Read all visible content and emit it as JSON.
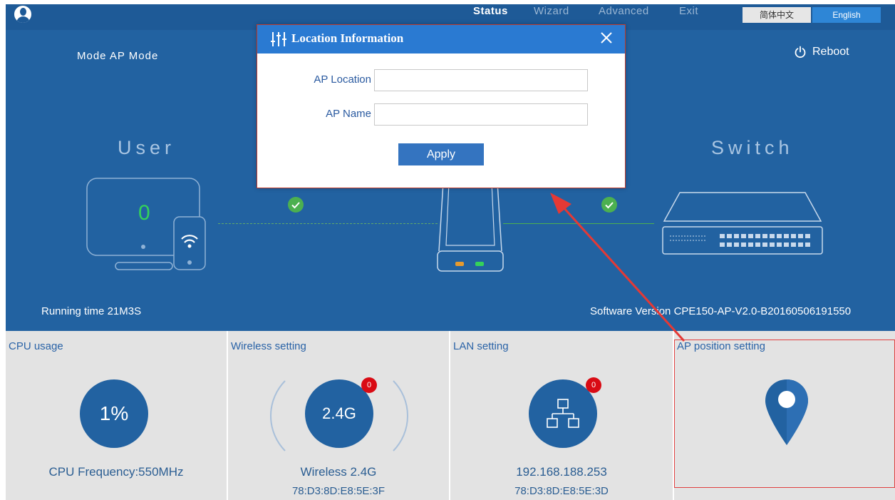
{
  "nav": {
    "items": [
      {
        "label": "Status",
        "active": true
      },
      {
        "label": "Wizard",
        "active": false
      },
      {
        "label": "Advanced",
        "active": false
      },
      {
        "label": "Exit",
        "active": false
      }
    ],
    "lang_cn": "简体中文",
    "lang_en": "English"
  },
  "status": {
    "mode_label": "Mode",
    "mode_value": "AP Mode",
    "reboot_label": "Reboot",
    "user_label": "User",
    "switch_label": "Switch",
    "user_count": "0",
    "running_time_label": "Running time",
    "running_time_value": "21M3S",
    "software_version_label": "Software Version",
    "software_version_value": "CPE150-AP-V2.0-B20160506191550"
  },
  "panels": {
    "cpu": {
      "title": "CPU usage",
      "value": "1%",
      "frequency": "CPU Frequency:550MHz"
    },
    "wireless": {
      "title": "Wireless setting",
      "band": "2.4G",
      "badge": "0",
      "name": "Wireless 2.4G",
      "mac": "78:D3:8D:E8:5E:3F"
    },
    "lan": {
      "title": "LAN setting",
      "badge": "0",
      "ip": "192.168.188.253",
      "mac": "78:D3:8D:E8:5E:3D"
    },
    "ap_position": {
      "title": "AP position setting"
    }
  },
  "dialog": {
    "title": "Location Information",
    "ap_location_label": "AP Location",
    "ap_location_value": "",
    "ap_name_label": "AP Name",
    "ap_name_value": "",
    "apply_label": "Apply"
  },
  "colors": {
    "primary_blue": "#2262a1",
    "dialog_header": "#2a7ad2",
    "status_green": "#4cb050",
    "badge_red": "#d90b14",
    "annotation_red": "#e53935"
  }
}
